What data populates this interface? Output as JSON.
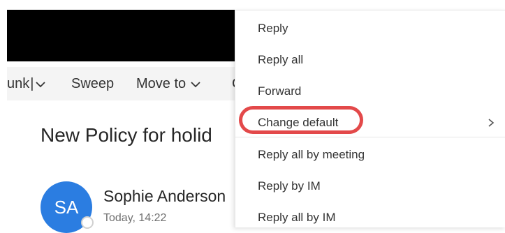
{
  "toolbar": {
    "junk_label": "unk",
    "sweep_label": "Sweep",
    "move_label": "Move to",
    "cut_label": "C"
  },
  "message": {
    "subject": "New Policy for holid",
    "sender_initials": "SA",
    "sender_name": "Sophie Anderson",
    "date": "Today, 14:22",
    "avatar_color": "#2b7de1"
  },
  "context_menu": {
    "items": [
      {
        "label": "Reply"
      },
      {
        "label": "Reply all"
      },
      {
        "label": "Forward"
      },
      {
        "label": "Change default",
        "has_submenu": true,
        "highlighted": true
      },
      {
        "label": "Reply all by meeting"
      },
      {
        "label": "Reply by IM"
      },
      {
        "label": "Reply all by IM"
      }
    ],
    "highlight_color": "#e3494a"
  },
  "icons": {
    "dropdown": "chevron-down-icon",
    "submenu": "chevron-right-icon"
  }
}
